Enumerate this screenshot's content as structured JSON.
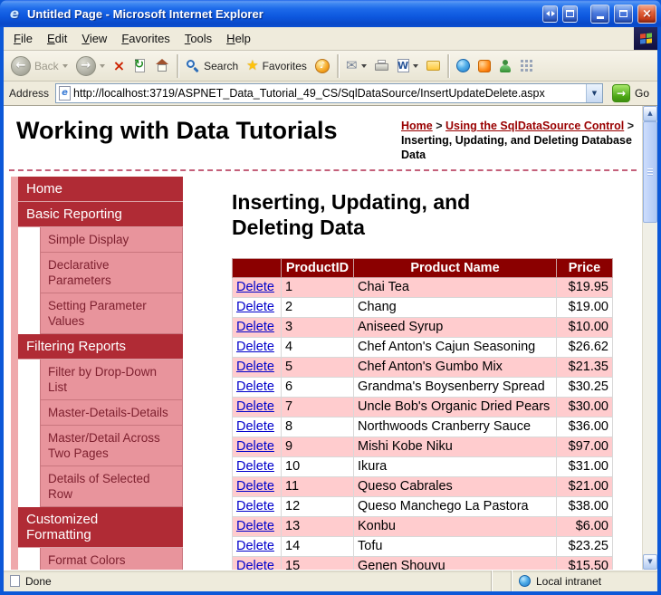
{
  "theme": {
    "titlebar_blue": "#0C58D8",
    "chrome_tan": "#ECE9D8",
    "table_header_maroon": "#8B0000",
    "sidebar_red": "#B02B35",
    "sidebar_pink": "#E8949C",
    "sidebar_strip_pink": "#EFA9AC",
    "row_pink": "#FFCCCE",
    "delete_link_blue": "#0000CC",
    "breadcrumb_maroon": "#990000",
    "go_green": "#4BA614"
  },
  "icons": {
    "ie_e": "e",
    "back": "←",
    "forward": "→",
    "stop": "×",
    "refresh": "↻",
    "favorites_star": "★",
    "media_note": "♪",
    "mail": "✉",
    "edit_w": "W",
    "dropdown_small": "▼",
    "go_arrow": "→",
    "scroll_up": "▲",
    "scroll_down": "▼",
    "close_x": "×"
  },
  "window": {
    "title": "Untitled Page - Microsoft Internet Explorer"
  },
  "menubar": {
    "items": [
      "File",
      "Edit",
      "View",
      "Favorites",
      "Tools",
      "Help"
    ]
  },
  "toolbar": {
    "back_label": "Back",
    "search_label": "Search",
    "favorites_label": "Favorites"
  },
  "addressbar": {
    "label": "Address",
    "url": "http://localhost:3719/ASPNET_Data_Tutorial_49_CS/SqlDataSource/InsertUpdateDelete.aspx",
    "go_label": "Go"
  },
  "page": {
    "title": "Working with Data Tutorials",
    "breadcrumb": {
      "home": "Home",
      "separator": ">",
      "section": "Using the SqlDataSource Control",
      "current": "Inserting, Updating, and Deleting Database Data"
    },
    "heading": "Inserting, Updating, and Deleting Data"
  },
  "sidebar": {
    "items": [
      {
        "label": "Home",
        "type": "main"
      },
      {
        "label": "Basic Reporting",
        "type": "main"
      },
      {
        "label": "Simple Display",
        "type": "sub"
      },
      {
        "label": "Declarative Parameters",
        "type": "sub"
      },
      {
        "label": "Setting Parameter Values",
        "type": "sub"
      },
      {
        "label": "Filtering Reports",
        "type": "main"
      },
      {
        "label": "Filter by Drop-Down List",
        "type": "sub"
      },
      {
        "label": "Master-Details-Details",
        "type": "sub"
      },
      {
        "label": "Master/Detail Across Two Pages",
        "type": "sub"
      },
      {
        "label": "Details of Selected Row",
        "type": "sub"
      },
      {
        "label": "Customized Formatting",
        "type": "main"
      },
      {
        "label": "Format Colors",
        "type": "sub"
      }
    ]
  },
  "products": {
    "delete_label": "Delete",
    "headers": {
      "id": "ProductID",
      "name": "Product Name",
      "price": "Price"
    },
    "rows": [
      {
        "id": "1",
        "name": "Chai Tea",
        "price": "$19.95"
      },
      {
        "id": "2",
        "name": "Chang",
        "price": "$19.00"
      },
      {
        "id": "3",
        "name": "Aniseed Syrup",
        "price": "$10.00"
      },
      {
        "id": "4",
        "name": "Chef Anton's Cajun Seasoning",
        "price": "$26.62"
      },
      {
        "id": "5",
        "name": "Chef Anton's Gumbo Mix",
        "price": "$21.35"
      },
      {
        "id": "6",
        "name": "Grandma's Boysenberry Spread",
        "price": "$30.25"
      },
      {
        "id": "7",
        "name": "Uncle Bob's Organic Dried Pears",
        "price": "$30.00"
      },
      {
        "id": "8",
        "name": "Northwoods Cranberry Sauce",
        "price": "$36.00"
      },
      {
        "id": "9",
        "name": "Mishi Kobe Niku",
        "price": "$97.00"
      },
      {
        "id": "10",
        "name": "Ikura",
        "price": "$31.00"
      },
      {
        "id": "11",
        "name": "Queso Cabrales",
        "price": "$21.00"
      },
      {
        "id": "12",
        "name": "Queso Manchego La Pastora",
        "price": "$38.00"
      },
      {
        "id": "13",
        "name": "Konbu",
        "price": "$6.00"
      },
      {
        "id": "14",
        "name": "Tofu",
        "price": "$23.25"
      },
      {
        "id": "15",
        "name": "Genen Shouyu",
        "price": "$15.50"
      }
    ]
  },
  "statusbar": {
    "status": "Done",
    "zone": "Local intranet"
  }
}
